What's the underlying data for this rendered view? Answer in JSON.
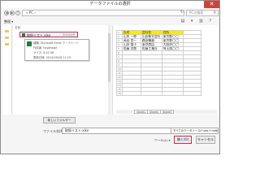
{
  "window": {
    "title": "データファイルの選択",
    "close_glyph": "✕"
  },
  "nav": {
    "back_glyph": "◀",
    "forward_glyph": "▶",
    "up_glyph": "↑",
    "address": "« PC ›",
    "refresh_glyph": "↻",
    "search_placeholder": "PCの検索",
    "search_glyph": "⚲"
  },
  "commands": {
    "organize_label": "整理 ▾",
    "icons": "▤ ▾ ▥ ?"
  },
  "file_list": {
    "column_header": "名前",
    "items": [
      {
        "name": "取扱リスト.xlsx",
        "date": "2015/09"
      }
    ],
    "tooltip": [
      "種類: Microsoft Excel ワークシート",
      "作成者: hogehoge",
      "サイズ: 8.41 KB",
      "更新日時: 2015/09/28 11:25"
    ]
  },
  "preview": {
    "rows": [
      {
        "n": "1",
        "cells": [
          "氏名",
          "会社名",
          "住所",
          ""
        ]
      },
      {
        "n": "2",
        "cells": [
          "山本 一郎",
          "山田株式会社",
          "東京都◯◯",
          ""
        ]
      },
      {
        "n": "3",
        "cells": [
          "高田 良一",
          "森田機器",
          "東京都◯◯",
          ""
        ]
      },
      {
        "n": "4",
        "cells": [
          "山本 陽子",
          "東京商店",
          "大阪府◯◯",
          ""
        ]
      },
      {
        "n": "5",
        "cells": [
          "佐藤 次郎",
          "佐藤工業社",
          "埼玉県◯◯",
          ""
        ]
      },
      {
        "n": "6",
        "cells": [
          "",
          "",
          "",
          ""
        ]
      },
      {
        "n": "7",
        "cells": [
          "",
          "",
          "",
          ""
        ]
      },
      {
        "n": "8",
        "cells": [
          "",
          "",
          "",
          ""
        ]
      },
      {
        "n": "9",
        "cells": [
          "",
          "",
          "",
          ""
        ]
      },
      {
        "n": "10",
        "cells": [
          "",
          "",
          "",
          ""
        ]
      },
      {
        "n": "11",
        "cells": [
          "",
          "",
          "",
          ""
        ]
      },
      {
        "n": "12",
        "cells": [
          "",
          "",
          "",
          ""
        ]
      },
      {
        "n": "13",
        "cells": [
          "",
          "",
          "",
          ""
        ]
      },
      {
        "n": "14",
        "cells": [
          "",
          "",
          "",
          ""
        ]
      },
      {
        "n": "15",
        "cells": [
          "",
          "",
          "",
          ""
        ]
      },
      {
        "n": "16",
        "cells": [
          "",
          "",
          "",
          ""
        ]
      }
    ],
    "sheet_tabs": [
      "Sheet1",
      "Sheet2",
      "Sheet3"
    ],
    "header_color": "#ffe900"
  },
  "buttons": {
    "new_folder": "新しいフォルダー",
    "open": "開く(O)",
    "cancel": "キャンセル"
  },
  "file_name": {
    "label": "ファイル名(N):",
    "value": "取扱リスト.xlsx"
  },
  "file_filter": {
    "value": "すべてのデータソース(*.odc;*.mdb)"
  },
  "tools_label": "ツール(L) ▾",
  "accent_highlight": "#d12a44"
}
